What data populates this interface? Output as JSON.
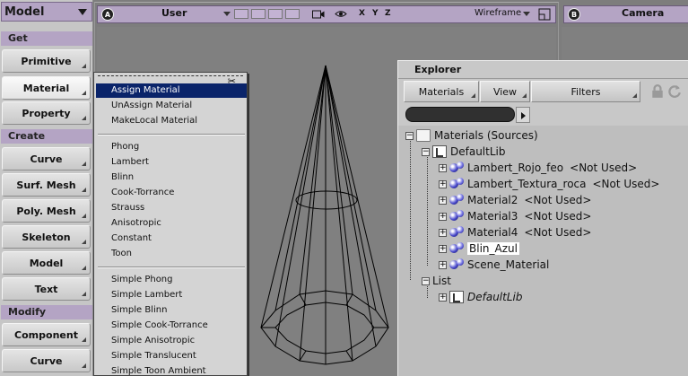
{
  "toolbar": {
    "mode": "Model",
    "sections": [
      {
        "title": "Get",
        "buttons": [
          "Primitive",
          "Material",
          "Property"
        ]
      },
      {
        "title": "Create",
        "buttons": [
          "Curve",
          "Surf. Mesh",
          "Poly. Mesh",
          "Skeleton",
          "Model",
          "Text"
        ]
      },
      {
        "title": "Modify",
        "buttons": [
          "Component",
          "Curve"
        ]
      }
    ],
    "active_button": "Material"
  },
  "viewport_a": {
    "badge": "A",
    "camera": "User",
    "axes": [
      "X",
      "Y",
      "Z"
    ],
    "shading": "Wireframe"
  },
  "viewport_b": {
    "badge": "B",
    "camera": "Camera"
  },
  "material_menu": {
    "groups": [
      [
        "Assign Material",
        "UnAssign Material",
        "MakeLocal Material"
      ],
      [
        "Phong",
        "Lambert",
        "Blinn",
        "Cook-Torrance",
        "Strauss",
        "Anisotropic",
        "Constant",
        "Toon"
      ],
      [
        "Simple Phong",
        "Simple Lambert",
        "Simple Blinn",
        "Simple Cook-Torrance",
        "Simple Anisotropic",
        "Simple Translucent",
        "Simple Toon Ambient"
      ]
    ],
    "highlighted": "Assign Material"
  },
  "explorer": {
    "title": "Explorer",
    "toolbar": {
      "scope": "Materials",
      "view": "View",
      "filters": "Filters"
    },
    "tree": {
      "root": "Materials (Sources)",
      "library": "DefaultLib",
      "materials": [
        {
          "name": "Lambert_Rojo_feo",
          "note": "<Not Used>"
        },
        {
          "name": "Lambert_Textura_roca",
          "note": "<Not Used>"
        },
        {
          "name": "Material2",
          "note": "<Not Used>"
        },
        {
          "name": "Material3",
          "note": "<Not Used>"
        },
        {
          "name": "Material4",
          "note": "<Not Used>"
        },
        {
          "name": "Blin_Azul",
          "note": ""
        },
        {
          "name": "Scene_Material",
          "note": ""
        }
      ],
      "selected": "Blin_Azul",
      "list_label": "List",
      "list_child": "DefaultLib"
    }
  },
  "colors": {
    "accent": "#b4a4c4",
    "menu_highlight": "#0a246a"
  },
  "icons": [
    "lock-icon",
    "refresh-icon",
    "camera-icon",
    "eye-icon",
    "maximize-icon",
    "close-icon"
  ]
}
